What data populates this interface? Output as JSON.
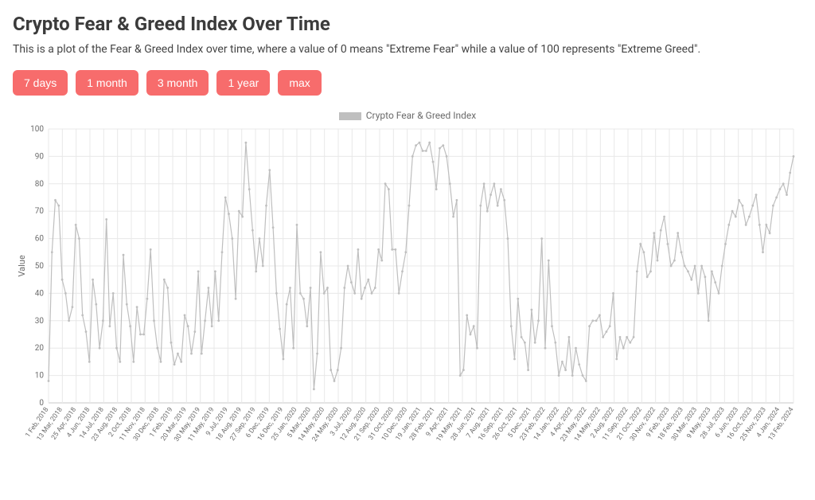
{
  "title": "Crypto Fear & Greed Index Over Time",
  "description": "This is a plot of the Fear & Greed Index over time, where a value of 0 means \"Extreme Fear\" while a value of 100 represents \"Extreme Greed\".",
  "range_buttons": {
    "d7": "7 days",
    "m1": "1 month",
    "m3": "3 month",
    "y1": "1 year",
    "max": "max"
  },
  "legend_label": "Crypto Fear & Greed Index",
  "y_axis_label": "Value",
  "chart_data": {
    "type": "line",
    "title": "Crypto Fear & Greed Index Over Time",
    "xlabel": "",
    "ylabel": "Value",
    "ylim": [
      0,
      100
    ],
    "y_ticks": [
      0,
      10,
      20,
      30,
      40,
      50,
      60,
      70,
      80,
      90,
      100
    ],
    "x_tick_labels": [
      "1 Feb, 2018",
      "13 Mar, 2018",
      "25 Apr, 2018",
      "4 Jun, 2018",
      "14 Jul, 2018",
      "23 Aug, 2018",
      "2 Oct, 2018",
      "11 Nov, 2018",
      "30 Dec, 2018",
      "1 Feb, 2019",
      "20 Mar, 2019",
      "30 May, 2019",
      "11 May, 2019",
      "9 Jul, 2019",
      "18 Aug, 2019",
      "27 Sep, 2019",
      "6 Dec, 2019",
      "16 Dec, 2019",
      "25 Jan, 2020",
      "5 Mar, 2020",
      "14 May, 2020",
      "24 May, 2020",
      "3 Jul, 2020",
      "12 Aug, 2020",
      "21 Sep, 2020",
      "31 Oct, 2020",
      "10 Dec, 2020",
      "19 Jan, 2021",
      "28 Feb, 2021",
      "9 Apr, 2021",
      "19 May, 2021",
      "28 Jun, 2021",
      "7 Aug, 2021",
      "16 Sep, 2021",
      "26 Oct, 2021",
      "5 Dec, 2021",
      "23 Feb, 2022",
      "14 Jan, 2022",
      "4 Apr, 2022",
      "23 May, 2022",
      "14 May, 2022",
      "2 Aug, 2022",
      "11 Sep, 2022",
      "21 Oct, 2022",
      "30 Nov, 2022",
      "9 Feb, 2023",
      "18 Feb, 2023",
      "30 Mar, 2023",
      "9 May, 2023",
      "28 Jul, 2023",
      "6 Jun, 2023",
      "16 Oct, 2023",
      "25 Nov, 2023",
      "4 Jan, 2024",
      "13 Feb, 2024"
    ],
    "series_name": "Crypto Fear & Greed Index",
    "x": [
      0,
      1,
      2,
      3,
      4,
      5,
      6,
      7,
      8,
      9,
      10,
      11,
      12,
      13,
      14,
      15,
      16,
      17,
      18,
      19,
      20,
      21,
      22,
      23,
      24,
      25,
      26,
      27,
      28,
      29,
      30,
      31,
      32,
      33,
      34,
      35,
      36,
      37,
      38,
      39,
      40,
      41,
      42,
      43,
      44,
      45,
      46,
      47,
      48,
      49,
      50,
      51,
      52,
      53,
      54,
      55,
      56,
      57,
      58,
      59,
      60,
      61,
      62,
      63,
      64,
      65,
      66,
      67,
      68,
      69,
      70,
      71,
      72,
      73,
      74,
      75,
      76,
      77,
      78,
      79,
      80,
      81,
      82,
      83,
      84,
      85,
      86,
      87,
      88,
      89,
      90,
      91,
      92,
      93,
      94,
      95,
      96,
      97,
      98,
      99,
      100,
      101,
      102,
      103,
      104,
      105,
      106,
      107,
      108,
      109,
      110,
      111,
      112,
      113,
      114,
      115,
      116,
      117,
      118,
      119,
      120,
      121,
      122,
      123,
      124,
      125,
      126,
      127,
      128,
      129,
      130,
      131,
      132,
      133,
      134,
      135,
      136,
      137,
      138,
      139,
      140,
      141,
      142,
      143,
      144,
      145,
      146,
      147,
      148,
      149,
      150,
      151,
      152,
      153,
      154,
      155,
      156,
      157,
      158,
      159,
      160,
      161,
      162,
      163,
      164,
      165,
      166,
      167,
      168,
      169,
      170,
      171,
      172,
      173,
      174,
      175,
      176,
      177,
      178,
      179,
      180,
      181,
      182,
      183,
      184,
      185,
      186,
      187,
      188,
      189,
      190,
      191,
      192,
      193,
      194,
      195,
      196,
      197,
      198,
      199,
      200,
      201,
      202,
      203,
      204,
      205,
      206,
      207,
      208,
      209,
      210,
      211,
      212,
      213,
      214,
      215,
      216,
      217,
      218,
      219
    ],
    "values": [
      8,
      55,
      74,
      72,
      45,
      40,
      30,
      35,
      65,
      60,
      32,
      26,
      15,
      45,
      36,
      20,
      30,
      67,
      28,
      40,
      20,
      15,
      54,
      36,
      28,
      15,
      35,
      25,
      25,
      38,
      56,
      30,
      20,
      15,
      45,
      42,
      22,
      14,
      18,
      15,
      32,
      28,
      18,
      26,
      48,
      18,
      30,
      42,
      28,
      48,
      30,
      55,
      75,
      69,
      60,
      38,
      70,
      68,
      95,
      78,
      63,
      48,
      60,
      50,
      72,
      85,
      64,
      40,
      27,
      16,
      36,
      42,
      20,
      65,
      40,
      38,
      28,
      42,
      5,
      18,
      55,
      40,
      42,
      12,
      8,
      12,
      20,
      42,
      50,
      44,
      40,
      56,
      38,
      42,
      45,
      40,
      42,
      56,
      52,
      80,
      78,
      56,
      56,
      40,
      48,
      55,
      72,
      90,
      94,
      95,
      92,
      92,
      95,
      88,
      78,
      93,
      94,
      90,
      80,
      68,
      74,
      10,
      12,
      32,
      25,
      28,
      20,
      72,
      80,
      70,
      76,
      80,
      72,
      78,
      74,
      60,
      28,
      16,
      38,
      24,
      22,
      12,
      34,
      22,
      30,
      60,
      20,
      52,
      28,
      22,
      10,
      15,
      12,
      24,
      10,
      20,
      14,
      10,
      8,
      28,
      30,
      30,
      32,
      24,
      26,
      28,
      40,
      16,
      24,
      20,
      24,
      22,
      24,
      48,
      58,
      55,
      46,
      48,
      62,
      52,
      63,
      68,
      58,
      50,
      52,
      62,
      55,
      50,
      48,
      45,
      50,
      40,
      50,
      46,
      30,
      48,
      44,
      40,
      50,
      58,
      65,
      70,
      68,
      74,
      72,
      65,
      68,
      72,
      76,
      65,
      55,
      65,
      62,
      72,
      75,
      78,
      80,
      76,
      84,
      90
    ]
  }
}
